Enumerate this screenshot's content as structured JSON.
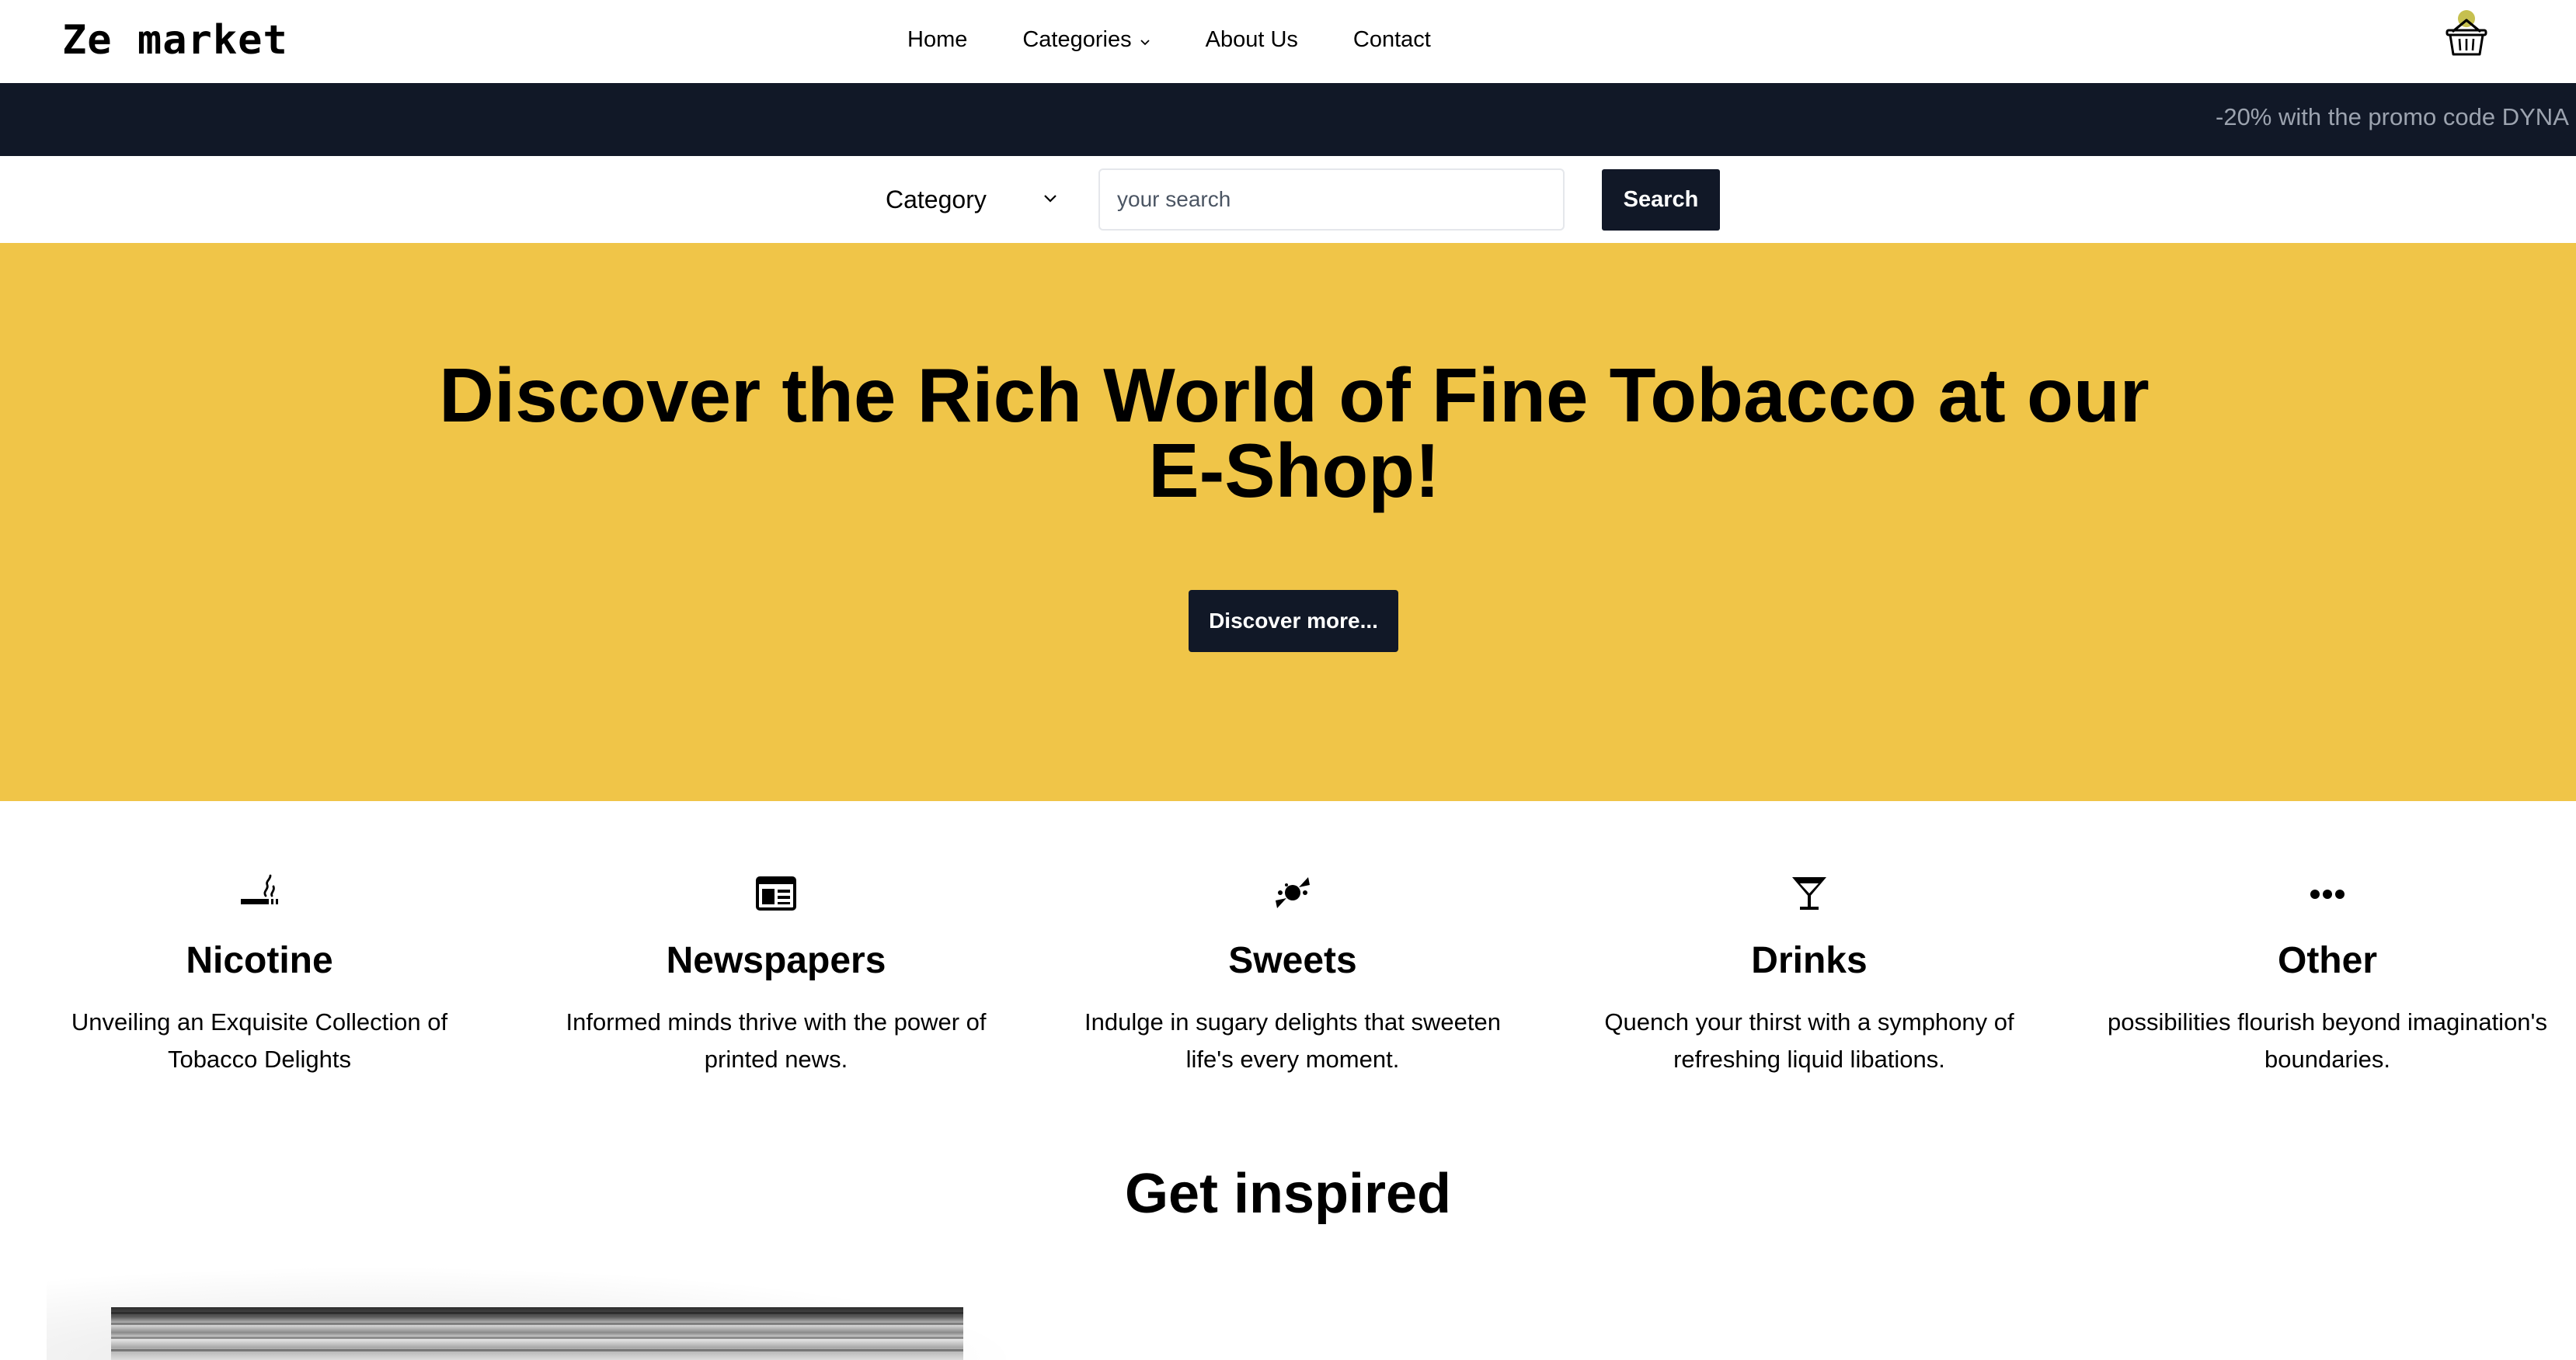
{
  "navbar": {
    "logo": "Ze market",
    "links": [
      {
        "label": "Home"
      },
      {
        "label": "Categories",
        "has_dropdown": true
      },
      {
        "label": "About Us"
      },
      {
        "label": "Contact"
      }
    ],
    "cart_icon": "basket-icon",
    "cart_badge_color": "#c6c04f"
  },
  "promo": {
    "text": "-20% with the promo code DYNA"
  },
  "search": {
    "category_label": "Category",
    "placeholder": "your search",
    "button_label": "Search"
  },
  "hero": {
    "title": "Discover the Rich World of Fine Tobacco at our E-Shop!",
    "button_label": "Discover more...",
    "background_color": "#f0c548"
  },
  "categories": [
    {
      "icon": "smoking-icon",
      "title": "Nicotine",
      "description": "Unveiling an Exquisite Collection of Tobacco Delights"
    },
    {
      "icon": "newspaper-icon",
      "title": "Newspapers",
      "description": "Informed minds thrive with the power of printed news."
    },
    {
      "icon": "candy-icon",
      "title": "Sweets",
      "description": "Indulge in sugary delights that sweeten life's every moment."
    },
    {
      "icon": "cocktail-icon",
      "title": "Drinks",
      "description": "Quench your thirst with a symphony of refreshing liquid libations."
    },
    {
      "icon": "ellipsis-icon",
      "title": "Other",
      "description": "possibilities flourish beyond imagination's boundaries."
    }
  ],
  "inspired": {
    "title": "Get inspired"
  },
  "colors": {
    "dark": "#111827",
    "accent": "#f0c548",
    "promo_text": "#9ca3af"
  }
}
